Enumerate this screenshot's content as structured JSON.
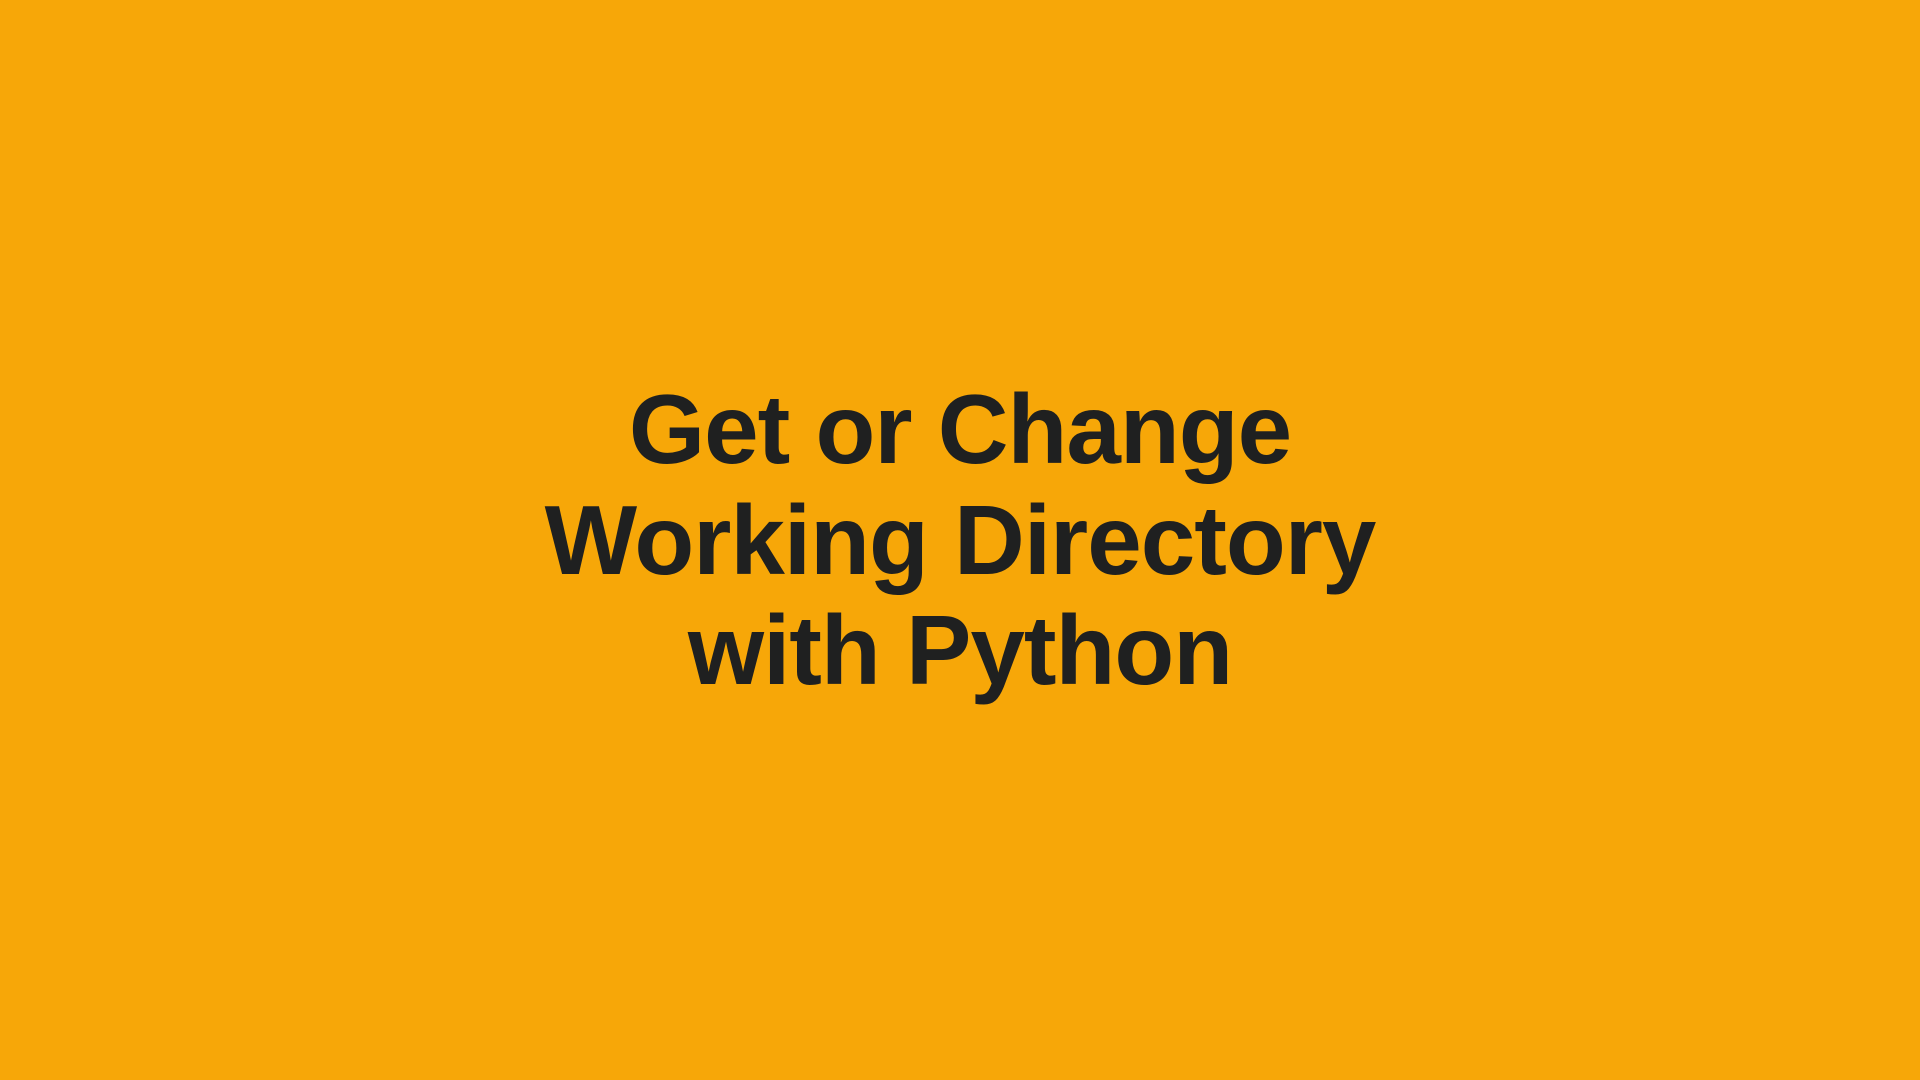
{
  "title": {
    "line1": "Get or Change",
    "line2": "Working Directory",
    "line3": "with Python"
  }
}
